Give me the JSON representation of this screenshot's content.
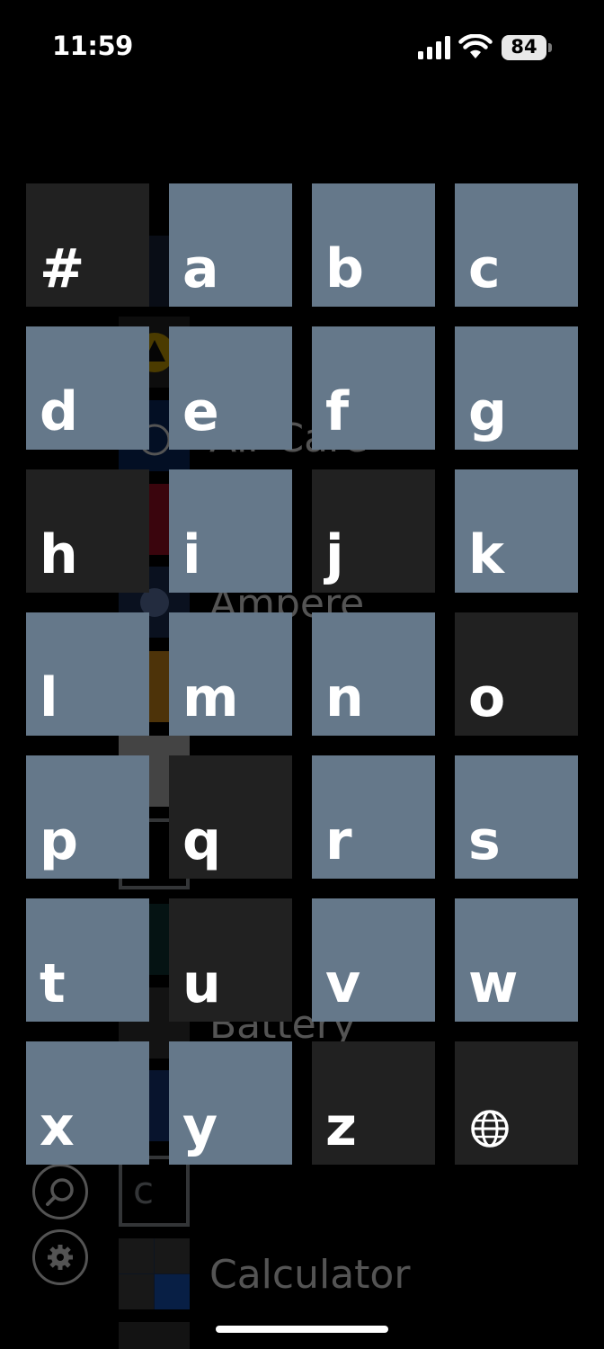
{
  "status_bar": {
    "time": "11:59",
    "battery_level": "84"
  },
  "background_apps": [
    {
      "name": "Air Care",
      "tile_color": "#0a2f6e",
      "label_visible": "Air Care"
    },
    {
      "name": "Ampere",
      "tile_color": "#20365e",
      "label_visible": "Ampere"
    },
    {
      "name": "Battery",
      "tile_color": "#6b6b6b",
      "label_visible": "Battery"
    },
    {
      "name": "Calculator",
      "tile_color": "#2a3e66",
      "label_visible": "Calculator"
    }
  ],
  "background_headers": {
    "c": "c"
  },
  "jump_grid": {
    "cells": [
      {
        "label": "#",
        "active": false
      },
      {
        "label": "a",
        "active": true
      },
      {
        "label": "b",
        "active": true
      },
      {
        "label": "c",
        "active": true
      },
      {
        "label": "d",
        "active": true
      },
      {
        "label": "e",
        "active": true
      },
      {
        "label": "f",
        "active": true
      },
      {
        "label": "g",
        "active": true
      },
      {
        "label": "h",
        "active": false
      },
      {
        "label": "i",
        "active": true
      },
      {
        "label": "j",
        "active": false
      },
      {
        "label": "k",
        "active": true
      },
      {
        "label": "l",
        "active": true
      },
      {
        "label": "m",
        "active": true
      },
      {
        "label": "n",
        "active": true
      },
      {
        "label": "o",
        "active": false
      },
      {
        "label": "p",
        "active": true
      },
      {
        "label": "q",
        "active": false
      },
      {
        "label": "r",
        "active": true
      },
      {
        "label": "s",
        "active": true
      },
      {
        "label": "t",
        "active": true
      },
      {
        "label": "u",
        "active": false
      },
      {
        "label": "v",
        "active": true
      },
      {
        "label": "w",
        "active": true
      },
      {
        "label": "x",
        "active": true
      },
      {
        "label": "y",
        "active": true
      },
      {
        "label": "z",
        "active": false
      },
      {
        "label": "",
        "icon": "globe-icon",
        "active": false
      }
    ]
  },
  "colors": {
    "active_tile": "#65788a",
    "inactive_tile": "#212121",
    "background": "#000000"
  }
}
